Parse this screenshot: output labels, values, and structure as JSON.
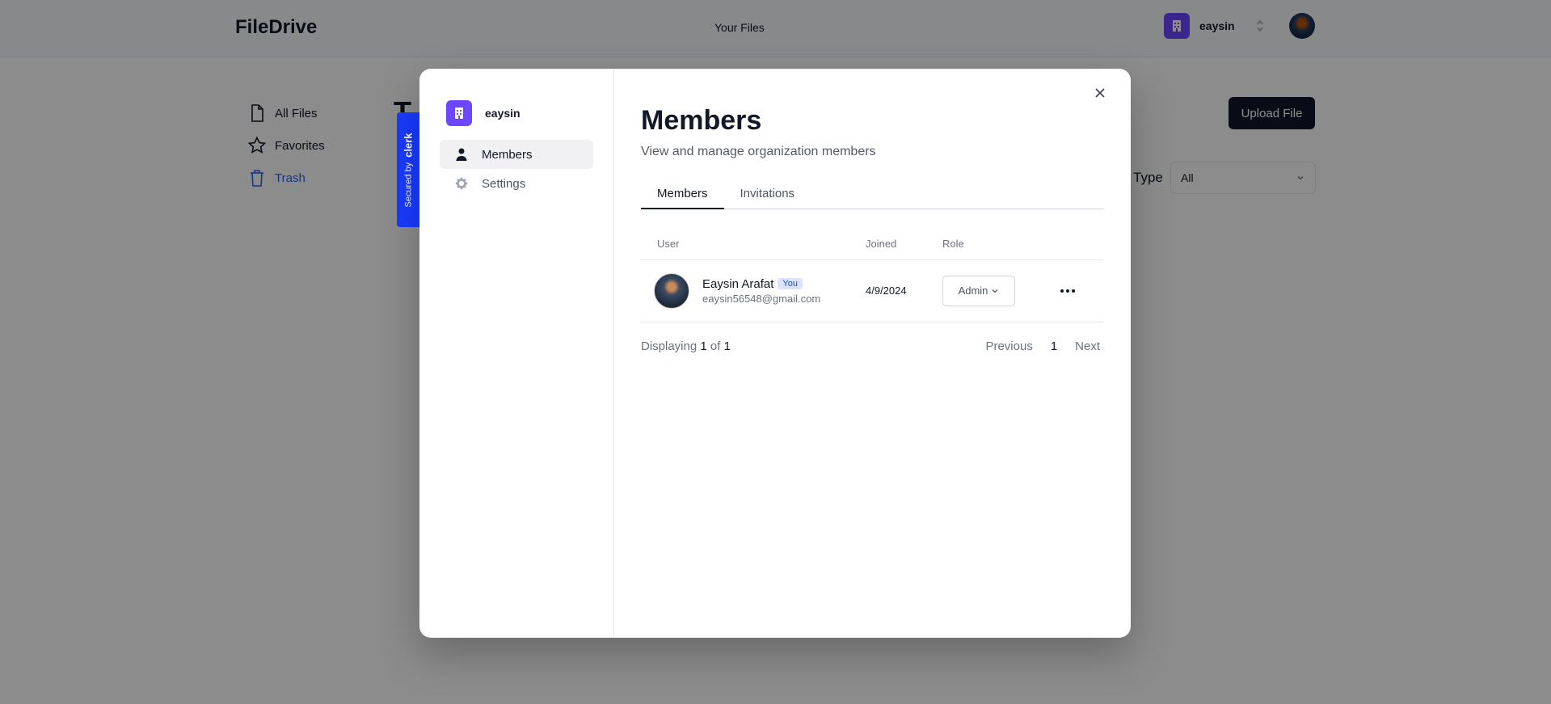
{
  "app": {
    "logo": "FileDrive",
    "nav_link": "Your Files",
    "org_name": "eaysin",
    "sidebar": [
      {
        "label": "All Files"
      },
      {
        "label": "Favorites"
      },
      {
        "label": "Trash"
      }
    ],
    "page_title_fragment": "T",
    "upload_label": "Upload File",
    "type_label": "Type",
    "type_value": "All"
  },
  "clerk_badge": {
    "secured_by": "Secured by",
    "brand": "clerk"
  },
  "modal": {
    "org_name": "eaysin",
    "nav": [
      {
        "label": "Members",
        "active": true
      },
      {
        "label": "Settings",
        "active": false
      }
    ],
    "title": "Members",
    "subtitle": "View and manage organization members",
    "tabs": [
      {
        "label": "Members",
        "active": true
      },
      {
        "label": "Invitations",
        "active": false
      }
    ],
    "table": {
      "headers": {
        "user": "User",
        "joined": "Joined",
        "role": "Role"
      },
      "rows": [
        {
          "name": "Eaysin Arafat",
          "badge": "You",
          "email": "eaysin56548@gmail.com",
          "joined": "4/9/2024",
          "role": "Admin"
        }
      ]
    },
    "pager": {
      "displaying": "Displaying",
      "current": "1",
      "of": "of",
      "total": "1",
      "previous": "Previous",
      "page": "1",
      "next": "Next"
    }
  }
}
